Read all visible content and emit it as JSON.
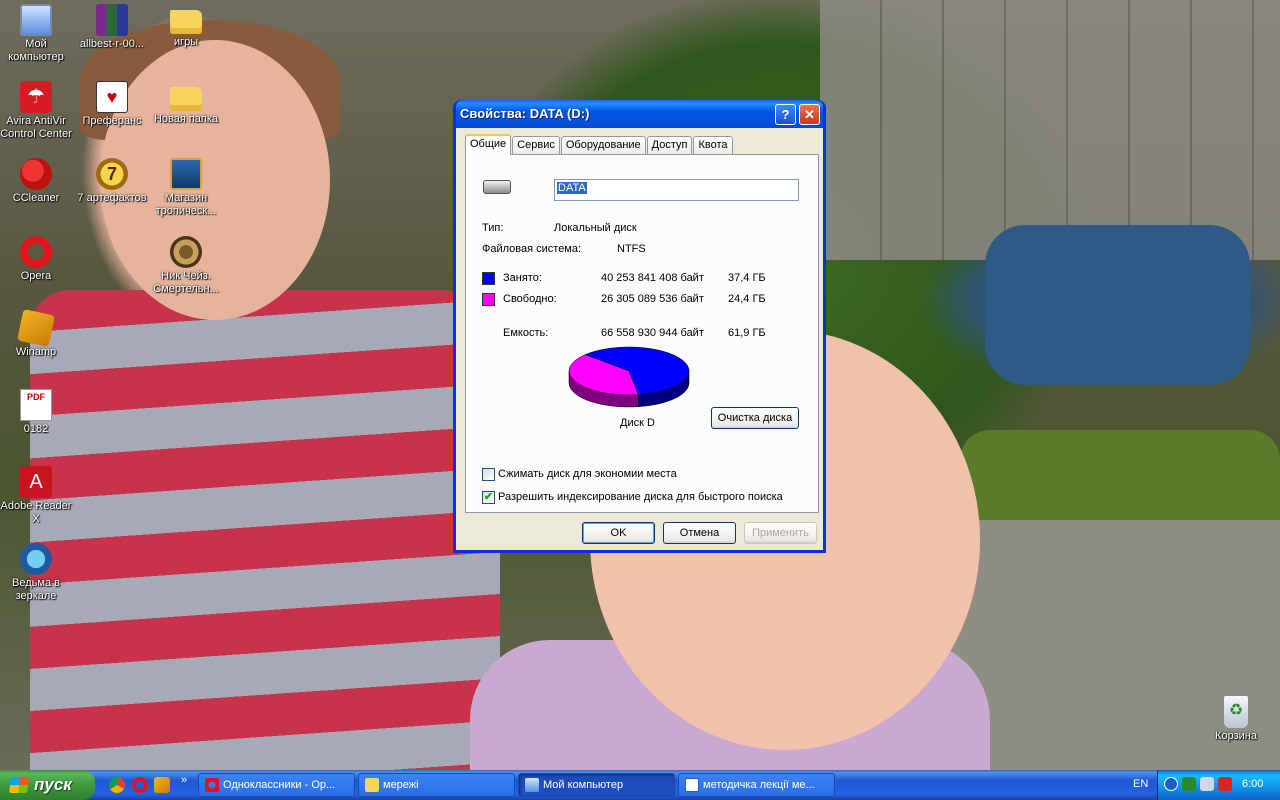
{
  "desktop": {
    "icons": [
      {
        "label": "Мой компьютер",
        "icon": "my-computer-icon",
        "glyph": ""
      },
      {
        "label": "allbest-r-00...",
        "icon": "winrar-archive-icon",
        "glyph": ""
      },
      {
        "label": "игры",
        "icon": "folder-icon",
        "glyph": ""
      },
      {
        "label": "Avira AntiVir Control Center",
        "icon": "avira-umbrella-icon",
        "glyph": "☂"
      },
      {
        "label": "Преферанс",
        "icon": "playing-cards-icon",
        "glyph": "♥"
      },
      {
        "label": "Новая папка",
        "icon": "folder-icon",
        "glyph": ""
      },
      {
        "label": "CCleaner",
        "icon": "ccleaner-icon",
        "glyph": ""
      },
      {
        "label": "7 артефактов",
        "icon": "seven-artifacts-icon",
        "glyph": "7"
      },
      {
        "label": "Магазин тропическ...",
        "icon": "tropical-shop-game-icon",
        "glyph": ""
      },
      {
        "label": "Opera",
        "icon": "opera-browser-icon",
        "glyph": ""
      },
      {
        "label": "Ник Чейз. Смертельн...",
        "icon": "nick-chase-game-icon",
        "glyph": ""
      },
      {
        "label": "Winamp",
        "icon": "winamp-icon",
        "glyph": ""
      },
      {
        "label": "0182",
        "icon": "pdf-file-icon",
        "glyph": "PDF"
      },
      {
        "label": "Adobe Reader X",
        "icon": "adobe-reader-icon",
        "glyph": "A"
      },
      {
        "label": "Ведьма в зеркале",
        "icon": "witch-mirror-game-icon",
        "glyph": ""
      },
      {
        "label": "Корзина",
        "icon": "recycle-bin-icon",
        "glyph": "♻"
      }
    ]
  },
  "dialog": {
    "title": "Свойства: DATA (D:)",
    "help_glyph": "?",
    "close_glyph": "✕",
    "tabs": [
      "Общие",
      "Сервис",
      "Оборудование",
      "Доступ",
      "Квота"
    ],
    "active_tab": 0,
    "volume_name": "DATA",
    "type_label": "Тип:",
    "type_value": "Локальный диск",
    "fs_label": "Файловая система:",
    "fs_value": "NTFS",
    "used": {
      "label": "Занято:",
      "bytes": "40 253 841 408 байт",
      "size": "37,4 ГБ",
      "color": "#0000ff"
    },
    "free": {
      "label": "Свободно:",
      "bytes": "26 305 089 536 байт",
      "size": "24,4 ГБ",
      "color": "#ff00ff"
    },
    "capacity": {
      "label": "Емкость:",
      "bytes": "66 558 930 944 байт",
      "size": "61,9 ГБ"
    },
    "disk_label": "Диск D",
    "cleanup_button": "Очистка диска",
    "compress_label": "Сжимать диск для экономии места",
    "compress_checked": false,
    "index_label": "Разрешить индексирование диска для быстрого поиска",
    "index_checked": true,
    "check_glyph": "✔",
    "ok": "OK",
    "cancel": "Отмена",
    "apply": "Применить"
  },
  "chart_data": {
    "type": "pie",
    "categories": [
      "Занято",
      "Свободно"
    ],
    "values": [
      40253841408,
      26305089536
    ],
    "colors": [
      "#0000ff",
      "#ff00ff"
    ]
  },
  "taskbar": {
    "start_label": "пуск",
    "chevron": "»",
    "tasks": [
      {
        "label": "Одноклассники - Ор...",
        "icon": "opera-icon",
        "active": false
      },
      {
        "label": "мережі",
        "icon": "folder-icon",
        "active": false
      },
      {
        "label": "Мой компьютер",
        "icon": "my-computer-icon",
        "active": true
      },
      {
        "label": "методичка лекції ме...",
        "icon": "document-icon",
        "active": false
      }
    ],
    "language": "EN",
    "clock": "6:00"
  }
}
